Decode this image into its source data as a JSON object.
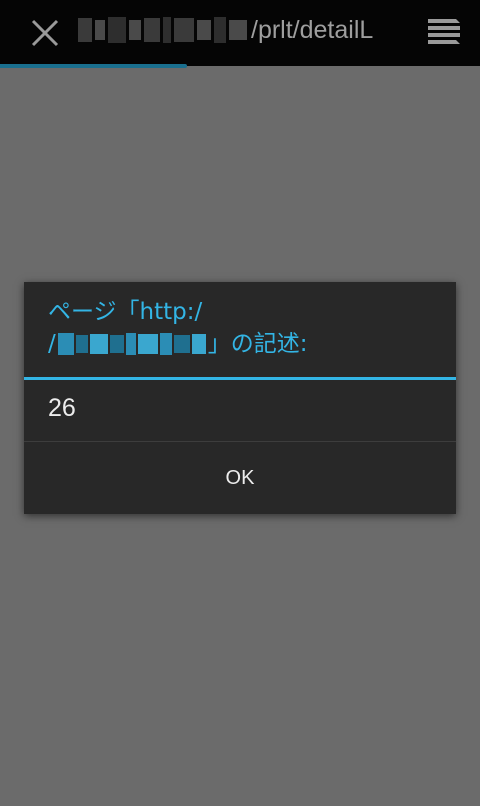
{
  "browser": {
    "close_icon": "close-icon",
    "url_suffix": "/prlt/detailL",
    "menu_icon": "tabs-menu-icon",
    "load_progress": 0.39,
    "accent": "#1a6f8e"
  },
  "dialog": {
    "title_prefix": "ページ「http:/",
    "title_line2_start": "/",
    "title_suffix": "」の記述:",
    "message": "26",
    "ok_label": "OK",
    "accent": "#33b5e5"
  }
}
